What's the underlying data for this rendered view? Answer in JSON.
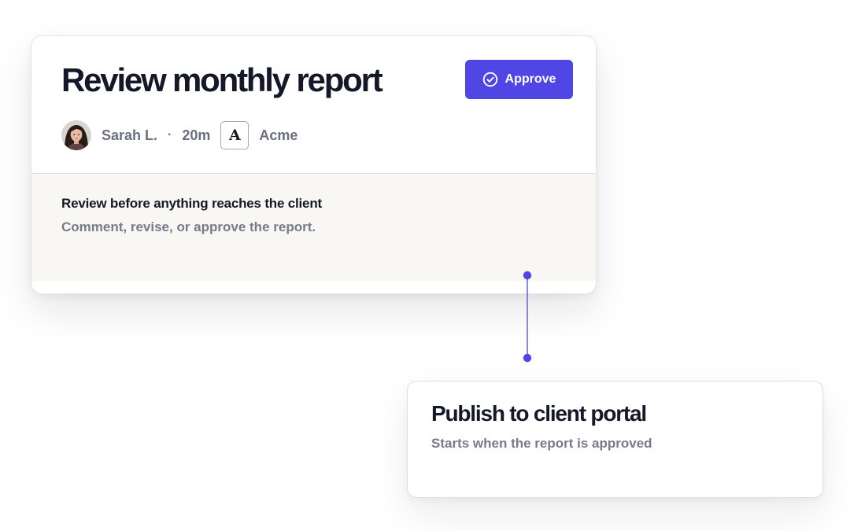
{
  "task": {
    "title": "Review monthly report",
    "approve_label": "Approve",
    "assignee": "Sarah L.",
    "separator": "·",
    "time_ago": "20m",
    "org_logo_letter": "A",
    "org_name": "Acme",
    "description_title": "Review before anything reaches the client",
    "description_text": "Comment, revise, or approve the report."
  },
  "next_step": {
    "title": "Publish to client portal",
    "subtitle": "Starts when the report is approved"
  },
  "icons": {
    "approve": "check-circle-icon",
    "avatar": "user-avatar"
  },
  "colors": {
    "accent": "#4f46e5",
    "text_primary": "#141828",
    "text_muted": "#6b7080",
    "panel_background": "#f8f7f3"
  }
}
